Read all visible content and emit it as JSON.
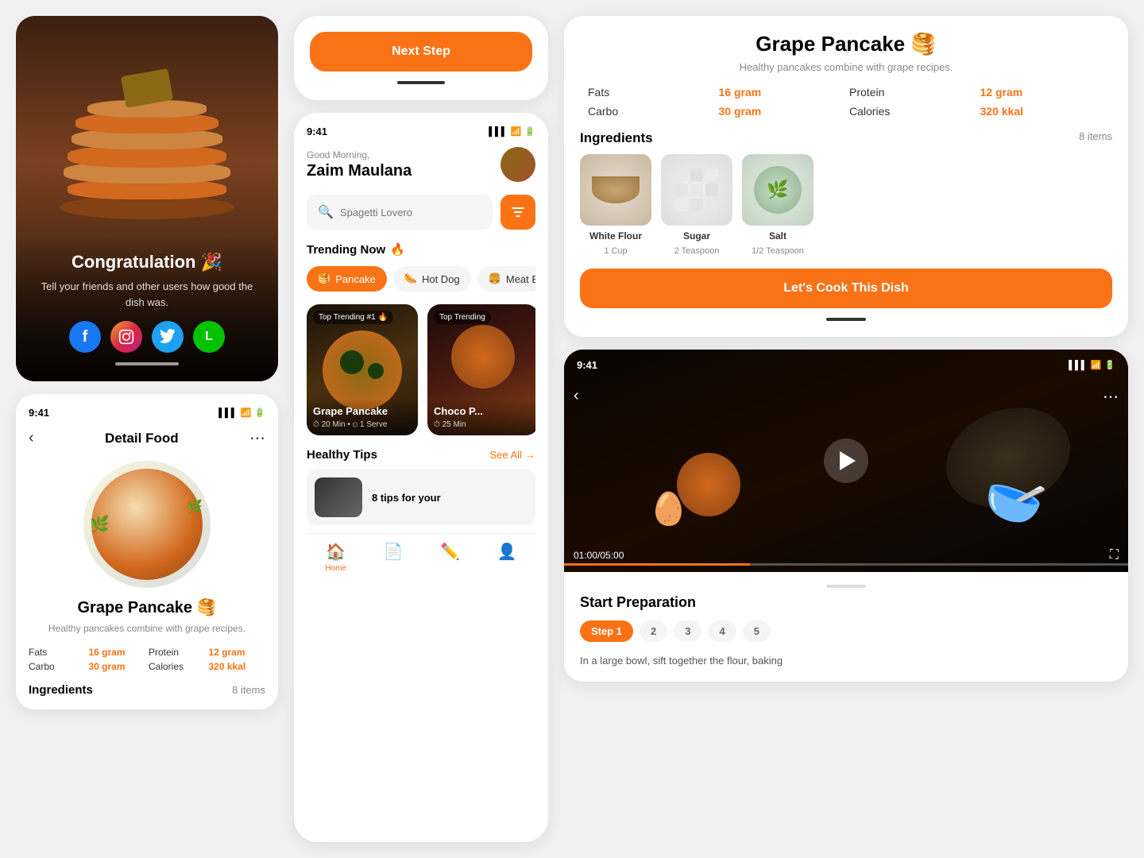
{
  "left": {
    "congrats": {
      "title": "Congratulation 🎉",
      "subtitle": "Tell your friends and other users how good the dish was.",
      "social": [
        {
          "name": "Facebook",
          "class": "social-fb",
          "icon": "f"
        },
        {
          "name": "Instagram",
          "class": "social-ig",
          "icon": "📷"
        },
        {
          "name": "Twitter",
          "class": "social-tw",
          "icon": "🐦"
        },
        {
          "name": "Line",
          "class": "social-line",
          "icon": "L"
        }
      ]
    },
    "detail": {
      "time": "9:41",
      "nav_title": "Detail Food",
      "food_title": "Grape Pancake 🥞",
      "food_desc": "Healthy pancakes combine with grape  recipes.",
      "nutrition": [
        {
          "label": "Fats",
          "value": "16 gram"
        },
        {
          "label": "Protein",
          "value": "12 gram"
        },
        {
          "label": "Carbo",
          "value": "30 gram"
        },
        {
          "label": "Calories",
          "value": "320 kkal"
        }
      ],
      "ingredients_title": "Ingredients",
      "ingredients_count": "8 items"
    }
  },
  "middle": {
    "next_step": {
      "button_label": "Next Step",
      "progress": 0.5
    },
    "app": {
      "time": "9:41",
      "greeting": "Good Morning,",
      "user_name": "Zaim Maulana",
      "search_placeholder": "Spagetti Lovero",
      "trending_title": "Trending Now",
      "categories": [
        {
          "label": "Pancake",
          "active": true
        },
        {
          "label": "Hot Dog",
          "active": false
        },
        {
          "label": "Meat Burg...",
          "active": false
        }
      ],
      "food_cards": [
        {
          "badge": "Top Trending #1 🔥",
          "name": "Grape Pancake",
          "time": "20 Min",
          "serve": "1 Serve"
        },
        {
          "badge": "Top Trending",
          "name": "Choco P...",
          "time": "25 Min",
          "serve": ""
        }
      ],
      "healthy_tips_title": "Healthy Tips",
      "see_all": "See All",
      "tips_text": "8 tips for your",
      "nav_items": [
        {
          "label": "Home",
          "icon": "🏠",
          "active": true
        },
        {
          "label": "",
          "icon": "📄",
          "active": false
        },
        {
          "label": "",
          "icon": "✏️",
          "active": false
        },
        {
          "label": "",
          "icon": "👤",
          "active": false
        }
      ]
    }
  },
  "right": {
    "recipe": {
      "title": "Grape Pancake 🥞",
      "desc": "Healthy pancakes combine with grape  recipes.",
      "nutrition": [
        {
          "label": "Fats",
          "value": "16 gram"
        },
        {
          "label": "Protein",
          "value": "12 gram"
        },
        {
          "label": "Carbo",
          "value": "30 gram"
        },
        {
          "label": "Calories",
          "value": "320 kkal"
        }
      ],
      "ingredients_title": "Ingredients",
      "ingredients_count": "8 items",
      "ingredients": [
        {
          "name": "White Flour",
          "amount": "1 Cup"
        },
        {
          "name": "Sugar",
          "amount": "2 Teaspoon"
        },
        {
          "name": "Salt",
          "amount": "1/2 Teaspoon"
        }
      ],
      "cook_btn": "Let's Cook This Dish"
    },
    "video": {
      "time": "9:41",
      "duration_current": "01:00",
      "duration_total": "05:00",
      "prep_title": "Start Preparation",
      "steps": [
        {
          "label": "Step 1",
          "active": true
        },
        {
          "label": "2",
          "active": false
        },
        {
          "label": "3",
          "active": false
        },
        {
          "label": "4",
          "active": false
        },
        {
          "label": "5",
          "active": false
        }
      ],
      "prep_text": "In a large bowl, sift together the flour, baking"
    }
  }
}
